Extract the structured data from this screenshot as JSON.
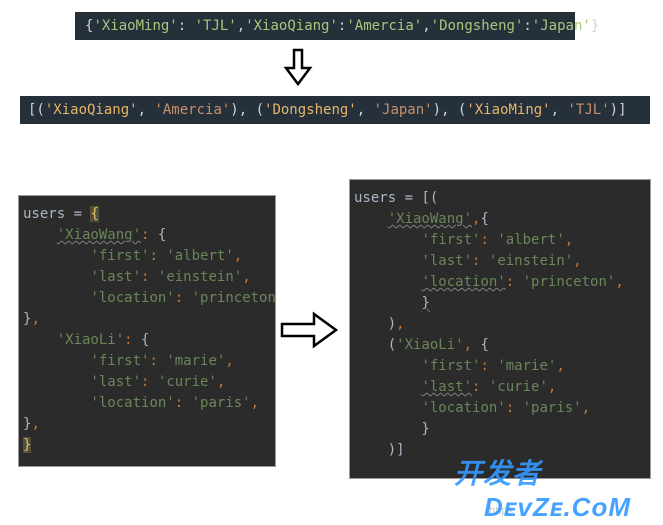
{
  "top_dict_line": "{'XiaoMing': 'TJL','XiaoQiang':'Amercia','Dongsheng':'Japan'}",
  "top_list_line": "[('XiaoQiang', 'Amercia'), ('Dongsheng', 'Japan'), ('XiaoMing', 'TJL')]",
  "top_dict_tokens": [
    {
      "t": "{",
      "c": "p"
    },
    {
      "t": "'XiaoMing'",
      "c": "s"
    },
    {
      "t": ": ",
      "c": "p"
    },
    {
      "t": "'TJL'",
      "c": "s"
    },
    {
      "t": ",",
      "c": "p"
    },
    {
      "t": "'XiaoQiang'",
      "c": "s"
    },
    {
      "t": ":",
      "c": "p"
    },
    {
      "t": "'Amercia'",
      "c": "s"
    },
    {
      "t": ",",
      "c": "p"
    },
    {
      "t": "'Dongsheng'",
      "c": "s"
    },
    {
      "t": ":",
      "c": "p"
    },
    {
      "t": "'Japan'",
      "c": "s"
    },
    {
      "t": "}",
      "c": "p"
    }
  ],
  "top_list_tokens": [
    {
      "t": "[(",
      "c": "p"
    },
    {
      "t": "'XiaoQiang'",
      "c": "o"
    },
    {
      "t": ", ",
      "c": "p"
    },
    {
      "t": "'Amercia'",
      "c": "s"
    },
    {
      "t": "), (",
      "c": "p"
    },
    {
      "t": "'Dongsheng'",
      "c": "o"
    },
    {
      "t": ", ",
      "c": "p"
    },
    {
      "t": "'Japan'",
      "c": "s"
    },
    {
      "t": "), (",
      "c": "p"
    },
    {
      "t": "'XiaoMing'",
      "c": "o"
    },
    {
      "t": ", ",
      "c": "p"
    },
    {
      "t": "'TJL'",
      "c": "s"
    },
    {
      "t": ")]",
      "c": "p"
    }
  ],
  "code_left": {
    "users_var": "users",
    "open": "{",
    "entries": [
      {
        "key": "XiaoWang",
        "first": "albert",
        "last": "einstein",
        "location": "princeton"
      },
      {
        "key": "XiaoLi",
        "first": "marie",
        "last": "curie",
        "location": "paris"
      }
    ],
    "close": "}"
  },
  "code_right": {
    "users_var": "users",
    "open": "[(",
    "entries": [
      {
        "key": "XiaoWang",
        "first": "albert",
        "last": "einstein",
        "location": "princeton",
        "wavy_location": true
      },
      {
        "key": "XiaoLi",
        "first": "marie",
        "last": "curie",
        "location": "paris",
        "wavy_last": true
      }
    ],
    "close": ")]"
  },
  "watermark": "开发者\n   DevZe.CoM",
  "watermark_url": "https"
}
